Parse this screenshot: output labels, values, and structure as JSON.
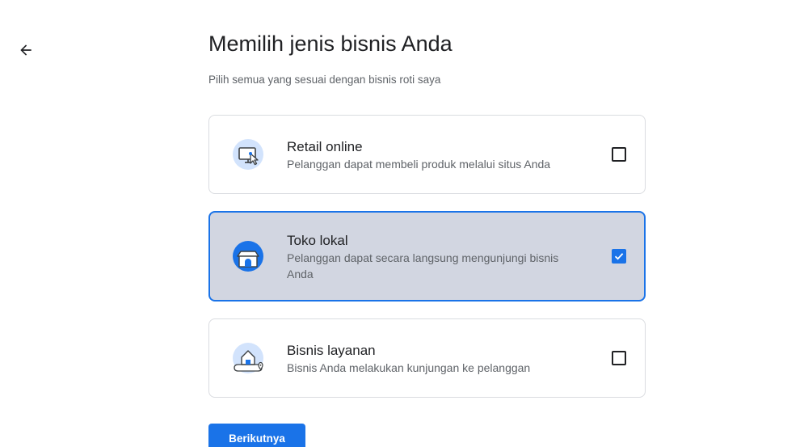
{
  "header": {
    "title": "Memilih jenis bisnis Anda",
    "subtitle": "Pilih semua yang sesuai dengan bisnis roti saya"
  },
  "options": [
    {
      "title": "Retail online",
      "description": "Pelanggan dapat membeli produk melalui situs Anda",
      "icon": "computer-cursor-icon",
      "checked": false
    },
    {
      "title": "Toko lokal",
      "description": "Pelanggan dapat secara langsung mengunjungi bisnis Anda",
      "icon": "storefront-icon",
      "checked": true
    },
    {
      "title": "Bisnis layanan",
      "description": "Bisnis Anda melakukan kunjungan ke pelanggan",
      "icon": "house-map-pin-icon",
      "checked": false
    }
  ],
  "actions": {
    "next_label": "Berikutnya"
  },
  "colors": {
    "accent": "#1a73e8",
    "selected_background": "#d2d6e1",
    "icon_light": "#d2e3fc"
  }
}
